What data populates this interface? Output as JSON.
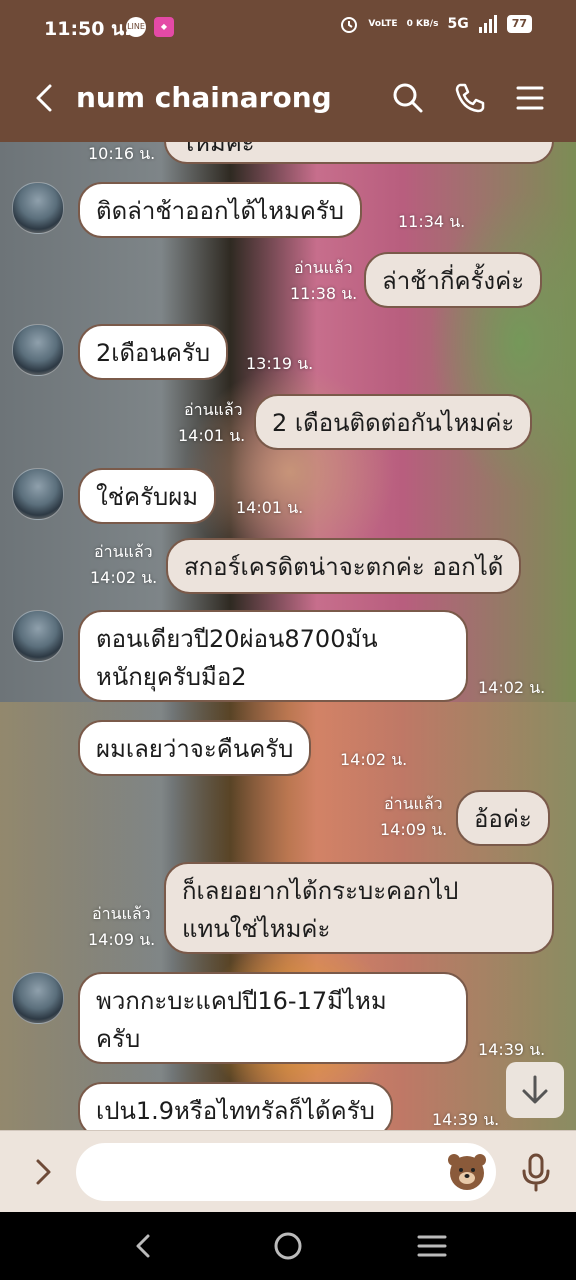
{
  "status_bar": {
    "time": "11:50 น.",
    "app_icons": [
      "line-icon",
      "game-app-icon"
    ],
    "volte": "VoLTE",
    "net_speed": "0 KB/s",
    "network": "5G",
    "battery": "77"
  },
  "header": {
    "title": "num chainarong",
    "icons": [
      "back-icon",
      "search-icon",
      "phone-icon",
      "menu-icon"
    ]
  },
  "messages": [
    {
      "dir": "out",
      "text": "ไหมคะ",
      "read": "",
      "time": "10:16 น."
    },
    {
      "dir": "in",
      "text": "ติดล่าช้าออกได้ไหมครับ",
      "time": "11:34 น."
    },
    {
      "dir": "out",
      "text": "ล่าช้ากี่ครั้งค่ะ",
      "read": "อ่านแล้ว",
      "time": "11:38 น."
    },
    {
      "dir": "in",
      "text": "2เดือนครับ",
      "time": "13:19 น."
    },
    {
      "dir": "out",
      "text": "2 เดือนติดต่อกันไหมค่ะ",
      "read": "อ่านแล้ว",
      "time": "14:01 น."
    },
    {
      "dir": "in",
      "text": "ใช่ครับผม",
      "time": "14:01 น."
    },
    {
      "dir": "out",
      "text": "สกอร์เครดิตน่าจะตกค่ะ ออกได้",
      "read": "อ่านแล้ว",
      "time": "14:02 น."
    },
    {
      "dir": "in",
      "text": "ตอนเดียวปี20ผ่อน8700มันหนักยุครับมือ2",
      "line1": "ตอนเดียวปี20ผ่อน8700มัน",
      "line2": "หนักยุครับมือ2",
      "time": "14:02 น."
    },
    {
      "dir": "in",
      "text": "ผมเลยว่าจะคืนครับ",
      "time": "14:02 น."
    },
    {
      "dir": "out",
      "text": "อ้อค่ะ",
      "read": "อ่านแล้ว",
      "time": "14:09 น."
    },
    {
      "dir": "out",
      "text": "ก็เลยอยากได้กระบะคอกไปแทนใช่ไหมค่ะ",
      "line1": "ก็เลยอยากได้กระบะคอกไป",
      "line2": "แทนใช่ไหมค่ะ",
      "read": "อ่านแล้ว",
      "time": "14:09 น."
    },
    {
      "dir": "in",
      "text": "พวกกะบะแคปปี16-17มีไหมครับ",
      "line1": "พวกกะบะแคปปี16-17มีไหม",
      "line2": "ครับ",
      "time": "14:39 น."
    },
    {
      "dir": "in",
      "text": "เปน1.9หรือไททรัลก็ได้ครับ",
      "time": "14:39 น."
    }
  ],
  "composer": {
    "placeholder": "",
    "icons": [
      "expand-icon",
      "sticker-icon",
      "microphone-icon"
    ]
  },
  "scroll_button_icon": "arrow-down-icon",
  "nav_bar": [
    "back-nav-icon",
    "home-nav-icon",
    "recents-nav-icon"
  ],
  "colors": {
    "header_bg": "#6e4a37",
    "incoming_bubble": "#ffffff",
    "outgoing_bubble": "#ece3dc",
    "composer_bg": "#ede4dc"
  }
}
